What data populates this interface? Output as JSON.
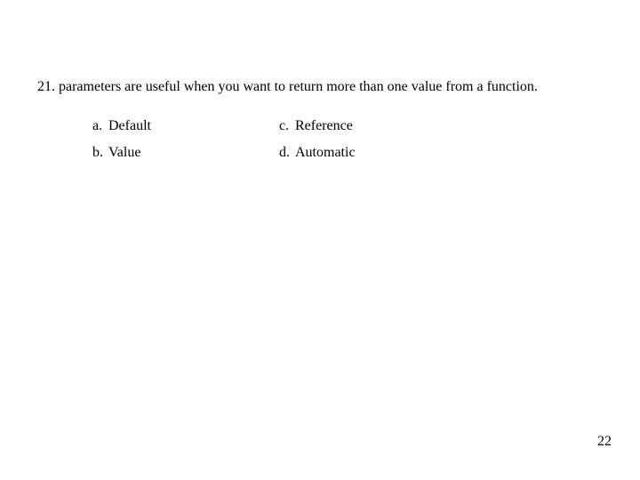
{
  "question": {
    "number": "21.",
    "text": "parameters are useful when you want to return more than one value from a function."
  },
  "options": {
    "a": {
      "letter": "a.",
      "text": "Default"
    },
    "b": {
      "letter": "b.",
      "text": "Value"
    },
    "c": {
      "letter": "c.",
      "text": "Reference"
    },
    "d": {
      "letter": "d.",
      "text": "Automatic"
    }
  },
  "page_number": "22"
}
